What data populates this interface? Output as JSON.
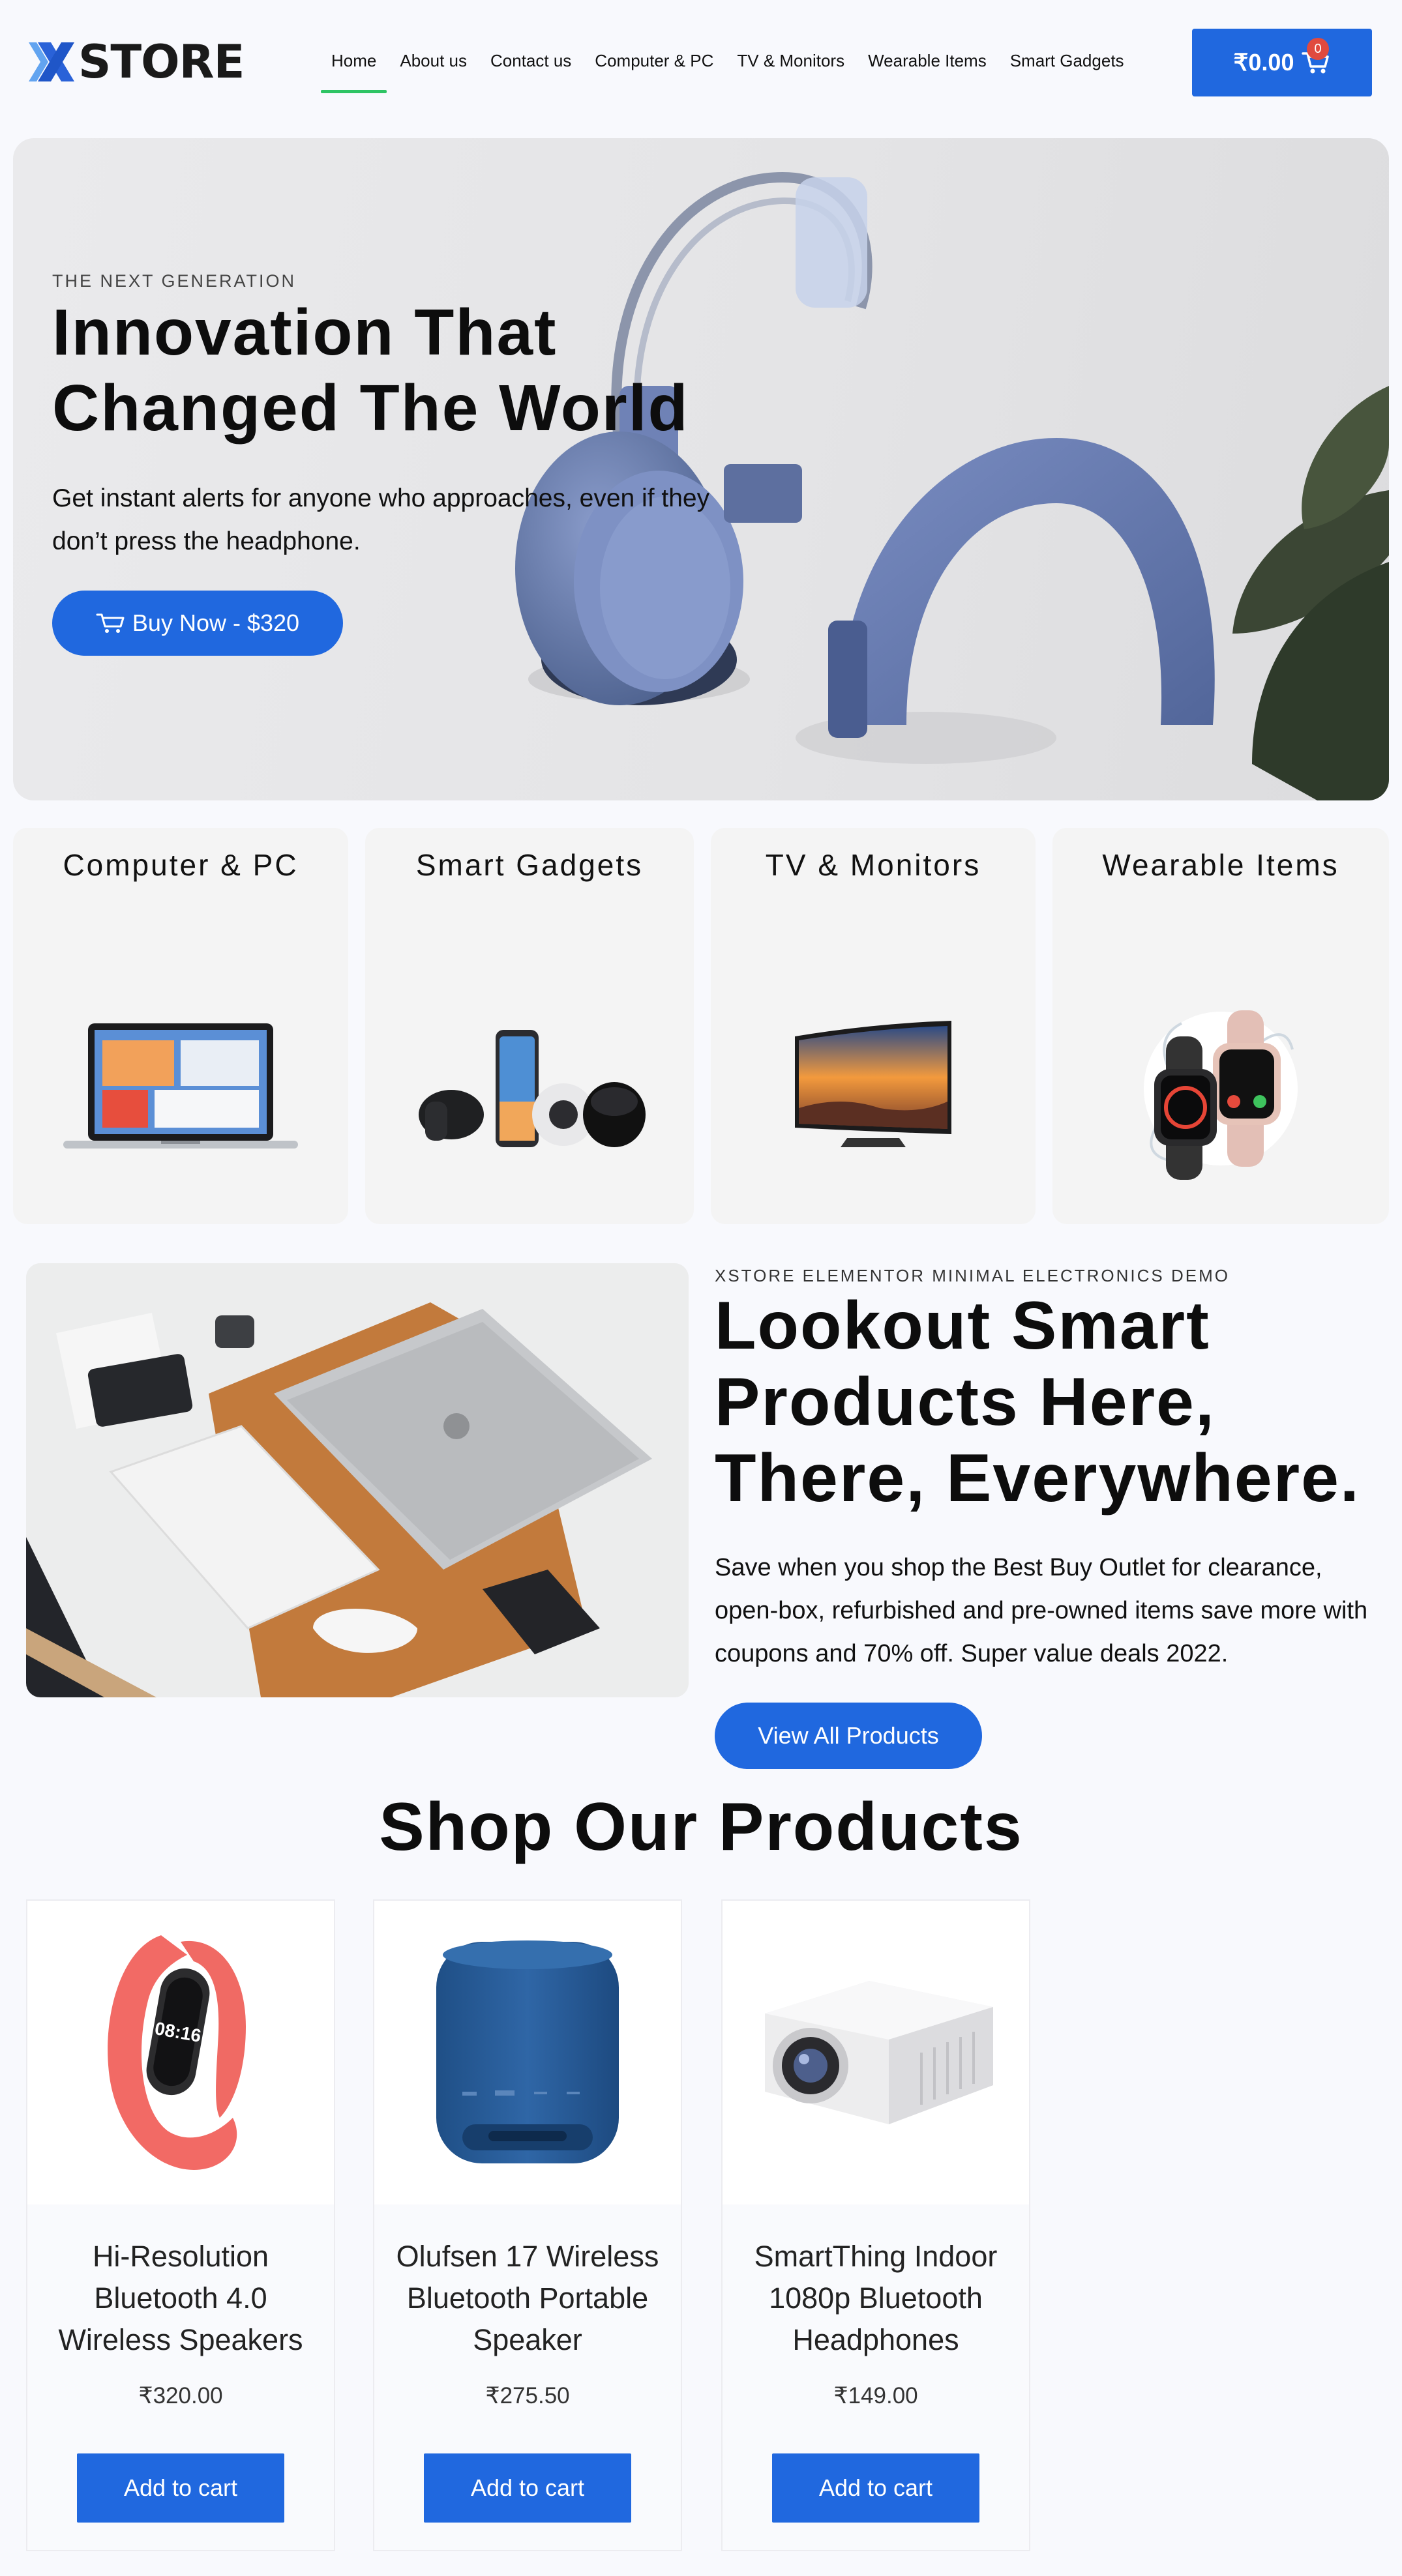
{
  "header": {
    "logo_text": "STORE",
    "logo_mark": "X",
    "nav": [
      {
        "label": "Home",
        "active": true
      },
      {
        "label": "About us"
      },
      {
        "label": "Contact us"
      },
      {
        "label": "Computer & PC"
      },
      {
        "label": "TV & Monitors"
      },
      {
        "label": "Wearable Items"
      },
      {
        "label": "Smart Gadgets"
      }
    ],
    "cart": {
      "amount": "₹0.00",
      "count": "0",
      "icon": "cart-icon"
    }
  },
  "hero": {
    "eyebrow": "THE NEXT GENERATION",
    "title_line1": "Innovation That",
    "title_line2": "Changed The World",
    "text": "Get instant alerts for anyone who approaches, even if they don’t press the headphone.",
    "button": "Buy Now - $320",
    "button_icon": "cart-icon"
  },
  "categories": [
    {
      "title": "Computer & PC",
      "icon": "laptop-image"
    },
    {
      "title": "Smart Gadgets",
      "icon": "gadgets-image"
    },
    {
      "title": "TV & Monitors",
      "icon": "tv-image"
    },
    {
      "title": "Wearable Items",
      "icon": "smartwatch-image"
    }
  ],
  "promo": {
    "eyebrow": "XSTORE ELEMENTOR MINIMAL ELECTRONICS DEMO",
    "title_line1": "Lookout Smart",
    "title_line2": "Products Here,",
    "title_line3": "There, Everywhere.",
    "text": "Save when you shop the Best Buy Outlet for clearance, open-box, refurbished and pre-owned items save more with coupons and 70% off. Super value deals 2022.",
    "button": "View All Products"
  },
  "products": {
    "title": "Shop Our Products",
    "items": [
      {
        "name": "Hi-Resolution Bluetooth 4.0 Wireless Speakers",
        "price": "₹320.00",
        "button": "Add to cart",
        "image": "fitness-band-image",
        "band_time": "08:16"
      },
      {
        "name": "Olufsen 17 Wireless Bluetooth Portable Speaker",
        "price": "₹275.50",
        "button": "Add to cart",
        "image": "blue-speaker-image"
      },
      {
        "name": "SmartThing Indoor 1080p Bluetooth Headphones",
        "price": "₹149.00",
        "button": "Add to cart",
        "image": "projector-image"
      }
    ]
  },
  "colors": {
    "accent": "#2068df",
    "nav_underline": "#2ec464",
    "badge": "#e04a3f",
    "page_bg": "#f8f9fd"
  }
}
